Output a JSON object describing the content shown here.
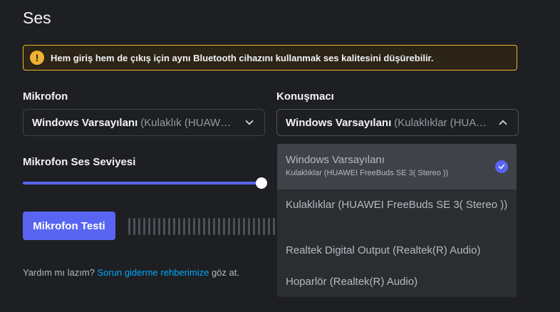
{
  "page": {
    "title": "Ses"
  },
  "warning": {
    "text": "Hem giriş hem de çıkış için aynı Bluetooth cihazını kullanmak ses kalitesini düşürebilir.",
    "icon": "exclamation-icon",
    "color": "#f0b232"
  },
  "microphone": {
    "label": "Mikrofon",
    "selected_main": "Windows Varsayılanı",
    "selected_sub": "(Kulaklık (HUAWEI ..."
  },
  "speaker": {
    "label": "Konuşmacı",
    "selected_main": "Windows Varsayılanı",
    "selected_sub": "(Kulaklıklar (HUAW..."
  },
  "mic_volume": {
    "label": "Mikrofon Ses Seviyesi",
    "value_percent": 100
  },
  "mic_test": {
    "button_label": "Mikrofon Testi"
  },
  "help": {
    "prefix": "Yardım mı lazım?",
    "link": "Sorun giderme rehberimize",
    "suffix": "göz at."
  },
  "speaker_dropdown": {
    "options": [
      {
        "label": "Windows Varsayılanı",
        "sublabel": "Kulaklıklar (HUAWEI FreeBuds SE 3( Stereo ))",
        "selected": true
      },
      {
        "label": "Kulaklıklar (HUAWEI FreeBuds SE 3( Stereo ))"
      },
      {
        "label": "Realtek Digital Output (Realtek(R) Audio)"
      },
      {
        "label": "Hoparlör (Realtek(R) Audio)"
      }
    ]
  },
  "colors": {
    "accent": "#5865f2",
    "background": "#1e1f22",
    "link": "#00a8fc"
  }
}
